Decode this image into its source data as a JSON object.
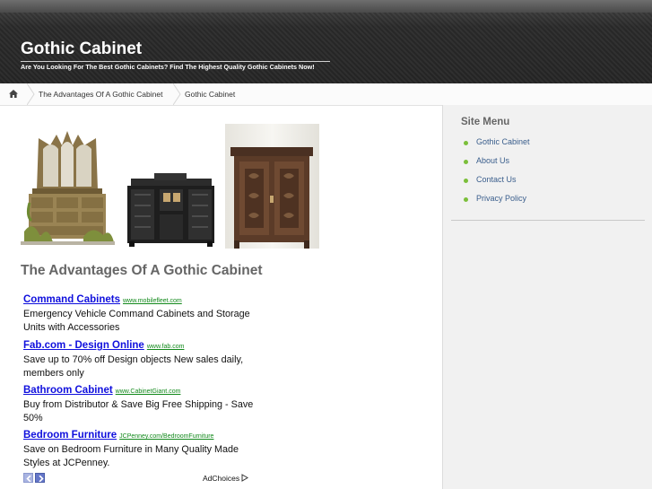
{
  "header": {
    "site_title": "Gothic Cabinet",
    "tagline": "Are You Looking For The Best Gothic Cabinets? Find The Highest Quality Gothic Cabinets Now!"
  },
  "breadcrumb": {
    "home_icon": "home-icon",
    "items": [
      "The Advantages Of A Gothic Cabinet",
      "Gothic Cabinet"
    ]
  },
  "post": {
    "title": "The Advantages Of A Gothic Cabinet"
  },
  "ads": [
    {
      "title": "Command Cabinets",
      "url": "www.mobilefleet.com",
      "desc": "Emergency Vehicle Command Cabinets and Storage Units with Accessories"
    },
    {
      "title": "Fab.com - Design Online",
      "url": "www.fab.com",
      "desc": "Save up to 70% off Design objects New sales daily, members only"
    },
    {
      "title": "Bathroom Cabinet",
      "url": "www.CabinetGiant.com",
      "desc": "Buy from Distributor & Save Big Free Shipping - Save 50%"
    },
    {
      "title": "Bedroom Furniture",
      "url": "JCPenney.com/BedroomFurniture",
      "desc": "Save on Bedroom Furniture in Many Quality Made Styles at JCPenney."
    }
  ],
  "ad_footer": {
    "adchoices_label": "AdChoices"
  },
  "sidebar": {
    "heading": "Site Menu",
    "items": [
      "Gothic Cabinet",
      "About Us",
      "Contact Us",
      "Privacy Policy"
    ]
  },
  "colors": {
    "link_blue": "#1010dd",
    "url_green": "#12891b",
    "menu_bullet": "#7bbf3a",
    "header_dark": "#2a2a2a"
  }
}
